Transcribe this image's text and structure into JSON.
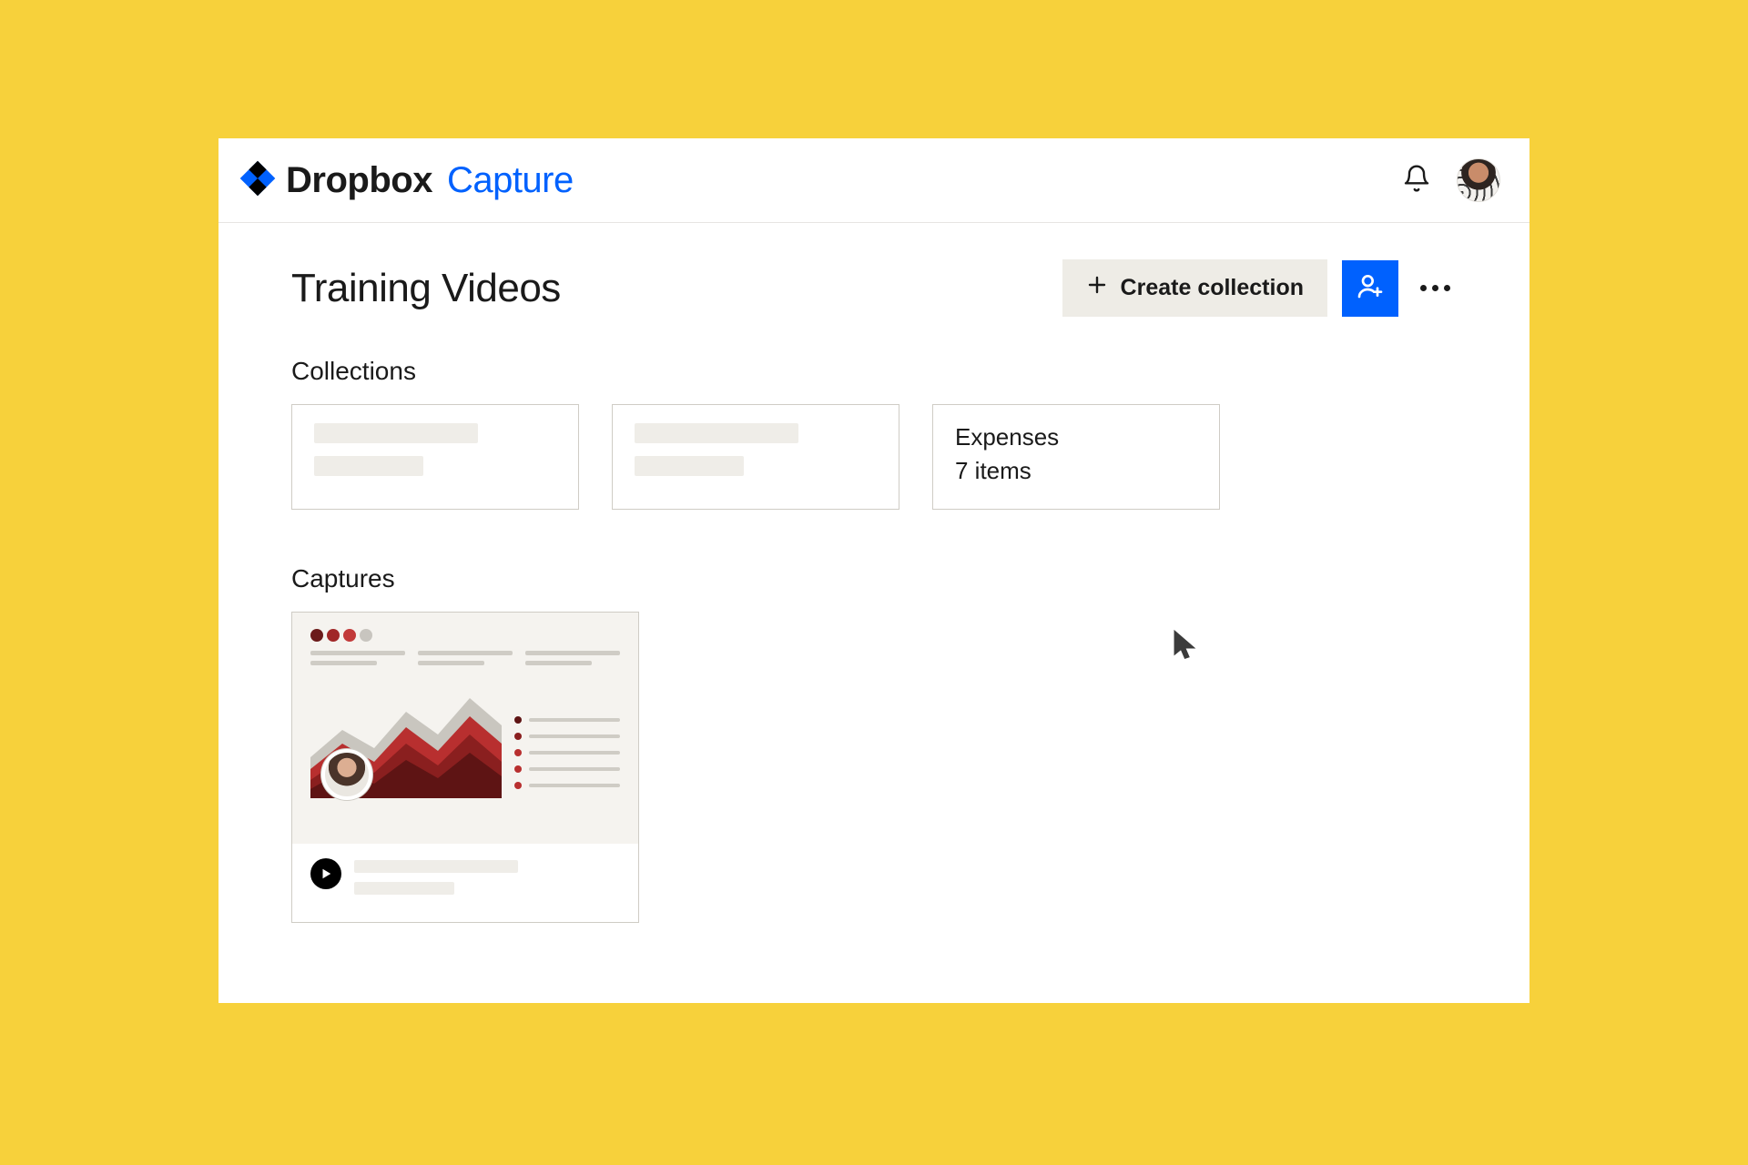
{
  "brand": {
    "name": "Dropbox",
    "product": "Capture"
  },
  "page": {
    "title": "Training Videos",
    "create_label": "Create collection"
  },
  "sections": {
    "collections_title": "Collections",
    "captures_title": "Captures"
  },
  "collections": [
    {
      "title": "",
      "subtitle": "",
      "placeholder": true
    },
    {
      "title": "",
      "subtitle": "",
      "placeholder": true
    },
    {
      "title": "Expenses",
      "subtitle": "7 items",
      "placeholder": false
    }
  ],
  "colors": {
    "accent": "#0061fe",
    "page_bg": "#f7d13b"
  }
}
